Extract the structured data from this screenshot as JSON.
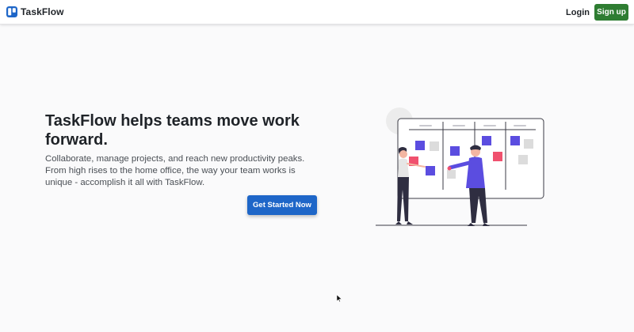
{
  "header": {
    "brand_name": "TaskFlow",
    "login_label": "Login",
    "signup_label": "Sign up"
  },
  "hero": {
    "title": "TaskFlow helps teams move work forward.",
    "subtitle": "Collaborate, manage projects, and reach new productivity peaks. From high rises to the home office, the way your team works is unique - accomplish it all with TaskFlow.",
    "cta_label": "Get Started Now"
  },
  "icons": {
    "brand_logo": "taskflow-logo-icon",
    "cursor": "mouse-pointer-icon"
  },
  "colors": {
    "brand_blue": "#1e66c8",
    "signup_green": "#2e7d32",
    "illustration_purple": "#5b4de0",
    "illustration_pink": "#f0516e",
    "illustration_gray": "#dcdcdc",
    "page_background": "#fafafb"
  }
}
